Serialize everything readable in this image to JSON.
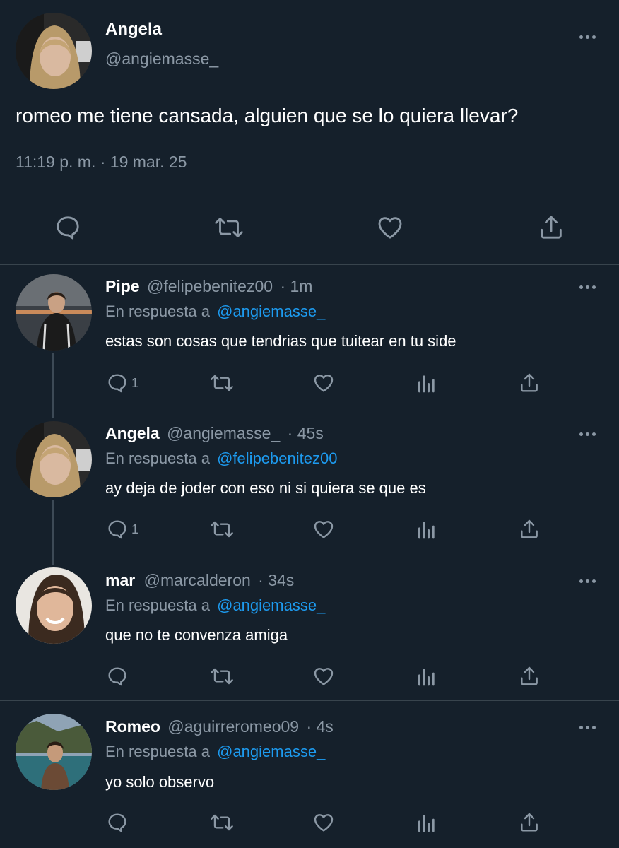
{
  "main_tweet": {
    "display_name": "Angela",
    "handle": "@angiemasse_",
    "text": "romeo me tiene cansada, alguien que se lo quiera llevar?",
    "timestamp": "11:19 p. m. · 19 mar. 25",
    "actions": [
      "reply-icon",
      "retweet-icon",
      "like-icon",
      "share-icon"
    ]
  },
  "replies": [
    {
      "display_name": "Pipe",
      "handle": "@felipebenitez00",
      "time": "· 1m",
      "reply_prefix": "En respuesta a",
      "reply_to": "@angiemasse_",
      "text": "estas son cosas que tendrias que tuitear en tu side",
      "reply_count": "1"
    },
    {
      "display_name": "Angela",
      "handle": "@angiemasse_",
      "time": "· 45s",
      "reply_prefix": "En respuesta a",
      "reply_to": "@felipebenitez00",
      "text": "ay deja de joder con eso ni si quiera se que es",
      "reply_count": "1"
    },
    {
      "display_name": "mar",
      "handle": "@marcalderon",
      "time": "· 34s",
      "reply_prefix": "En respuesta a",
      "reply_to": "@angiemasse_",
      "text": "que no te convenza amiga",
      "reply_count": ""
    },
    {
      "display_name": "Romeo",
      "handle": "@aguirreromeo09",
      "time": "· 4s",
      "reply_prefix": "En respuesta a",
      "reply_to": "@angiemasse_",
      "text": "yo solo observo",
      "reply_count": ""
    }
  ],
  "colors": {
    "background": "#15202b",
    "muted_text": "#8b98a5",
    "link": "#1d9bf0",
    "divider": "#38444d"
  }
}
